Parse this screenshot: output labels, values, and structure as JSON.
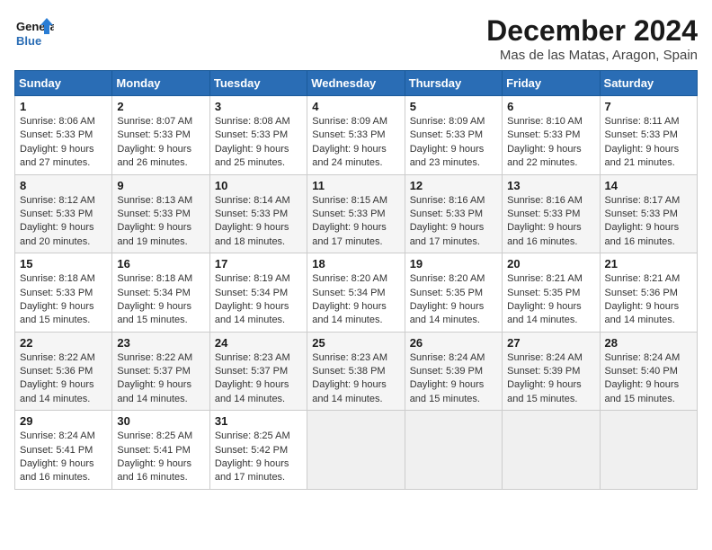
{
  "header": {
    "logo_line1": "General",
    "logo_line2": "Blue",
    "month_title": "December 2024",
    "location": "Mas de las Matas, Aragon, Spain"
  },
  "days_of_week": [
    "Sunday",
    "Monday",
    "Tuesday",
    "Wednesday",
    "Thursday",
    "Friday",
    "Saturday"
  ],
  "weeks": [
    [
      {
        "day": "1",
        "sunrise": "8:06 AM",
        "sunset": "5:33 PM",
        "daylight": "9 hours and 27 minutes."
      },
      {
        "day": "2",
        "sunrise": "8:07 AM",
        "sunset": "5:33 PM",
        "daylight": "9 hours and 26 minutes."
      },
      {
        "day": "3",
        "sunrise": "8:08 AM",
        "sunset": "5:33 PM",
        "daylight": "9 hours and 25 minutes."
      },
      {
        "day": "4",
        "sunrise": "8:09 AM",
        "sunset": "5:33 PM",
        "daylight": "9 hours and 24 minutes."
      },
      {
        "day": "5",
        "sunrise": "8:09 AM",
        "sunset": "5:33 PM",
        "daylight": "9 hours and 23 minutes."
      },
      {
        "day": "6",
        "sunrise": "8:10 AM",
        "sunset": "5:33 PM",
        "daylight": "9 hours and 22 minutes."
      },
      {
        "day": "7",
        "sunrise": "8:11 AM",
        "sunset": "5:33 PM",
        "daylight": "9 hours and 21 minutes."
      }
    ],
    [
      {
        "day": "8",
        "sunrise": "8:12 AM",
        "sunset": "5:33 PM",
        "daylight": "9 hours and 20 minutes."
      },
      {
        "day": "9",
        "sunrise": "8:13 AM",
        "sunset": "5:33 PM",
        "daylight": "9 hours and 19 minutes."
      },
      {
        "day": "10",
        "sunrise": "8:14 AM",
        "sunset": "5:33 PM",
        "daylight": "9 hours and 18 minutes."
      },
      {
        "day": "11",
        "sunrise": "8:15 AM",
        "sunset": "5:33 PM",
        "daylight": "9 hours and 17 minutes."
      },
      {
        "day": "12",
        "sunrise": "8:16 AM",
        "sunset": "5:33 PM",
        "daylight": "9 hours and 17 minutes."
      },
      {
        "day": "13",
        "sunrise": "8:16 AM",
        "sunset": "5:33 PM",
        "daylight": "9 hours and 16 minutes."
      },
      {
        "day": "14",
        "sunrise": "8:17 AM",
        "sunset": "5:33 PM",
        "daylight": "9 hours and 16 minutes."
      }
    ],
    [
      {
        "day": "15",
        "sunrise": "8:18 AM",
        "sunset": "5:33 PM",
        "daylight": "9 hours and 15 minutes."
      },
      {
        "day": "16",
        "sunrise": "8:18 AM",
        "sunset": "5:34 PM",
        "daylight": "9 hours and 15 minutes."
      },
      {
        "day": "17",
        "sunrise": "8:19 AM",
        "sunset": "5:34 PM",
        "daylight": "9 hours and 14 minutes."
      },
      {
        "day": "18",
        "sunrise": "8:20 AM",
        "sunset": "5:34 PM",
        "daylight": "9 hours and 14 minutes."
      },
      {
        "day": "19",
        "sunrise": "8:20 AM",
        "sunset": "5:35 PM",
        "daylight": "9 hours and 14 minutes."
      },
      {
        "day": "20",
        "sunrise": "8:21 AM",
        "sunset": "5:35 PM",
        "daylight": "9 hours and 14 minutes."
      },
      {
        "day": "21",
        "sunrise": "8:21 AM",
        "sunset": "5:36 PM",
        "daylight": "9 hours and 14 minutes."
      }
    ],
    [
      {
        "day": "22",
        "sunrise": "8:22 AM",
        "sunset": "5:36 PM",
        "daylight": "9 hours and 14 minutes."
      },
      {
        "day": "23",
        "sunrise": "8:22 AM",
        "sunset": "5:37 PM",
        "daylight": "9 hours and 14 minutes."
      },
      {
        "day": "24",
        "sunrise": "8:23 AM",
        "sunset": "5:37 PM",
        "daylight": "9 hours and 14 minutes."
      },
      {
        "day": "25",
        "sunrise": "8:23 AM",
        "sunset": "5:38 PM",
        "daylight": "9 hours and 14 minutes."
      },
      {
        "day": "26",
        "sunrise": "8:24 AM",
        "sunset": "5:39 PM",
        "daylight": "9 hours and 15 minutes."
      },
      {
        "day": "27",
        "sunrise": "8:24 AM",
        "sunset": "5:39 PM",
        "daylight": "9 hours and 15 minutes."
      },
      {
        "day": "28",
        "sunrise": "8:24 AM",
        "sunset": "5:40 PM",
        "daylight": "9 hours and 15 minutes."
      }
    ],
    [
      {
        "day": "29",
        "sunrise": "8:24 AM",
        "sunset": "5:41 PM",
        "daylight": "9 hours and 16 minutes."
      },
      {
        "day": "30",
        "sunrise": "8:25 AM",
        "sunset": "5:41 PM",
        "daylight": "9 hours and 16 minutes."
      },
      {
        "day": "31",
        "sunrise": "8:25 AM",
        "sunset": "5:42 PM",
        "daylight": "9 hours and 17 minutes."
      },
      null,
      null,
      null,
      null
    ]
  ],
  "labels": {
    "sunrise": "Sunrise:",
    "sunset": "Sunset:",
    "daylight": "Daylight:"
  }
}
